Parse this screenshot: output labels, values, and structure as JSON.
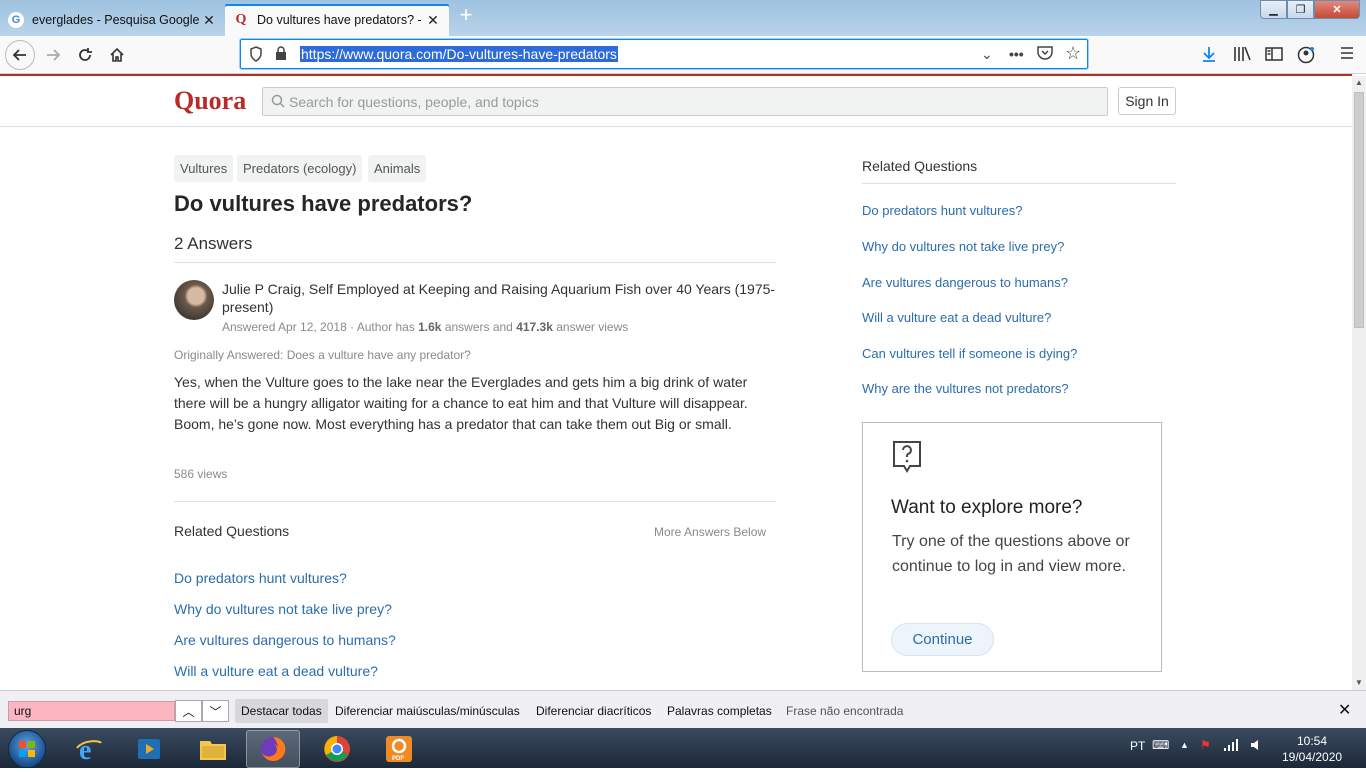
{
  "browser": {
    "tabs": [
      {
        "title": "everglades - Pesquisa Google",
        "icon": "google-icon"
      },
      {
        "title": "Do vultures have predators? - Q",
        "icon": "quora-icon"
      }
    ],
    "url": "https://www.quora.com/Do-vultures-have-predators"
  },
  "quora": {
    "logo": "Quora",
    "search_placeholder": "Search for questions, people, and topics",
    "sign_in": "Sign In",
    "topics": [
      "Vultures",
      "Predators (ecology)",
      "Animals"
    ],
    "question_title": "Do vultures have predators?",
    "answer_count": "2 Answers",
    "answer": {
      "author_line": "Julie P Craig, Self Employed at Keeping and Raising Aquarium Fish over 40 Years (1975-present)",
      "answered_prefix": "Answered Apr 12, 2018 · Author has ",
      "answers_count": "1.6k",
      "answers_mid": " answers and ",
      "answer_views": "417.3k",
      "answers_suffix": " answer views",
      "originally_answered": "Originally Answered: Does a vulture have any predator?",
      "text": "Yes, when the Vulture goes to the lake near the Everglades and gets him a big drink of water there will be a hungry alligator waiting for a chance to eat him and that Vulture will disappear. Boom, he’s gone now. Most everything has a predator that can take them out Big or small.",
      "views": "586 views"
    },
    "related_main": {
      "title": "Related Questions",
      "more": "More Answers Below",
      "items": [
        "Do predators hunt vultures?",
        "Why do vultures not take live prey?",
        "Are vultures dangerous to humans?",
        "Will a vulture eat a dead vulture?"
      ]
    },
    "related_side": {
      "title": "Related Questions",
      "items": [
        "Do predators hunt vultures?",
        "Why do vultures not take live prey?",
        "Are vultures dangerous to humans?",
        "Will a vulture eat a dead vulture?",
        "Can vultures tell if someone is dying?",
        "Why are the vultures not predators?"
      ]
    },
    "explore": {
      "title": "Want to explore more?",
      "text": "Try one of the questions above or continue to log in and view more.",
      "button": "Continue"
    }
  },
  "findbar": {
    "query": "urg",
    "highlight_all": "Destacar todas",
    "match_case": "Diferenciar maiúsculas/minúsculas",
    "match_diacritics": "Diferenciar diacríticos",
    "whole_words": "Palavras completas",
    "status": "Frase não encontrada"
  },
  "taskbar": {
    "language": "PT",
    "time": "10:54",
    "date": "19/04/2020"
  },
  "colors": {
    "quora_red": "#b92b27",
    "link_blue": "#2b6dad",
    "find_not_found": "#fbb6c2"
  }
}
